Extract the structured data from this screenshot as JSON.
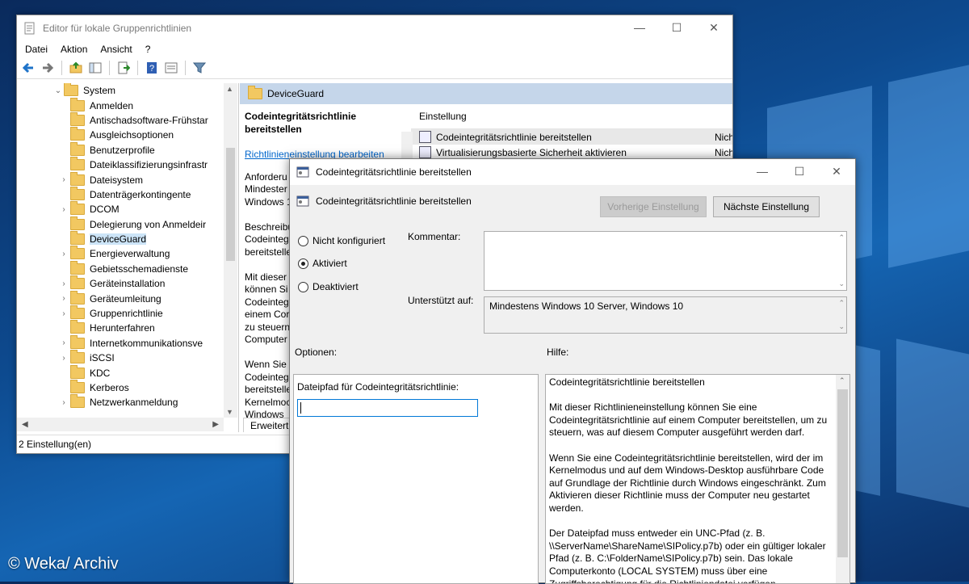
{
  "watermark": "© Weka/ Archiv",
  "main_window": {
    "title": "Editor für lokale Gruppenrichtlinien",
    "menu": [
      "Datei",
      "Aktion",
      "Ansicht",
      "?"
    ],
    "tree": {
      "root": "System",
      "items": [
        {
          "label": "Anmelden",
          "expandable": false
        },
        {
          "label": "Antischadsoftware-Frühstar",
          "expandable": false
        },
        {
          "label": "Ausgleichsoptionen",
          "expandable": false
        },
        {
          "label": "Benutzerprofile",
          "expandable": false
        },
        {
          "label": "Dateiklassifizierungsinfrastr",
          "expandable": false
        },
        {
          "label": "Dateisystem",
          "expandable": true
        },
        {
          "label": "Datenträgerkontingente",
          "expandable": false
        },
        {
          "label": "DCOM",
          "expandable": true
        },
        {
          "label": "Delegierung von Anmeldeir",
          "expandable": false
        },
        {
          "label": "DeviceGuard",
          "expandable": false,
          "selected": true
        },
        {
          "label": "Energieverwaltung",
          "expandable": true
        },
        {
          "label": "Gebietsschemadienste",
          "expandable": false
        },
        {
          "label": "Geräteinstallation",
          "expandable": true
        },
        {
          "label": "Geräteumleitung",
          "expandable": true
        },
        {
          "label": "Gruppenrichtlinie",
          "expandable": true
        },
        {
          "label": "Herunterfahren",
          "expandable": false
        },
        {
          "label": "Internetkommunikationsve",
          "expandable": true
        },
        {
          "label": "iSCSI",
          "expandable": true
        },
        {
          "label": "KDC",
          "expandable": false
        },
        {
          "label": "Kerberos",
          "expandable": false
        },
        {
          "label": "Netzwerkanmeldung",
          "expandable": true
        }
      ]
    },
    "right_pane": {
      "header": "DeviceGuard",
      "desc_title": "Codeintegritätsrichtlinie bereitstellen",
      "desc_link": "Richtlinieneinstellung bearbeiten",
      "desc_lines": [
        "Anforderu",
        "Mindester",
        "Windows 1",
        "",
        "Beschreibu",
        "Codeinteg",
        "bereitstelle",
        "",
        "Mit dieser",
        "können Si",
        "Codeinteg",
        "einem Cor",
        "zu steuern",
        "Computer",
        "",
        "Wenn Sie",
        "Codeinteg",
        "bereitstelle",
        "Kernelmoc",
        "Windows"
      ],
      "column_header": "Einstellung",
      "rows": [
        {
          "label": "Codeintegritätsrichtlinie bereitstellen",
          "state": "Nich"
        },
        {
          "label": "Virtualisierungsbasierte Sicherheit aktivieren",
          "state": "Nich"
        }
      ],
      "tab": "Erweitert"
    },
    "status": "2 Einstellung(en)"
  },
  "dialog": {
    "title": "Codeintegritätsrichtlinie bereitstellen",
    "subtitle": "Codeintegritätsrichtlinie bereitstellen",
    "prev_button": "Vorherige Einstellung",
    "next_button": "Nächste Einstellung",
    "radios": [
      {
        "label": "Nicht konfiguriert",
        "checked": false
      },
      {
        "label": "Aktiviert",
        "checked": true
      },
      {
        "label": "Deaktiviert",
        "checked": false
      }
    ],
    "comment_label": "Kommentar:",
    "comment_value": "",
    "supported_label": "Unterstützt auf:",
    "supported_value": "Mindestens Windows 10 Server, Windows 10",
    "options_label": "Optionen:",
    "help_label": "Hilfe:",
    "filepath_label": "Dateipfad für Codeintegritätsrichtlinie:",
    "filepath_value": "",
    "help_text": "Codeintegritätsrichtlinie bereitstellen\n\nMit dieser Richtlinieneinstellung können Sie eine Codeintegritätsrichtlinie auf einem Computer bereitstellen, um zu steuern, was auf diesem Computer ausgeführt werden darf.\n\nWenn Sie eine Codeintegritätsrichtlinie bereitstellen, wird der im Kernelmodus und auf dem Windows-Desktop ausführbare Code auf Grundlage der Richtlinie durch Windows eingeschränkt. Zum Aktivieren dieser Richtlinie muss der Computer neu gestartet werden.\n\nDer Dateipfad muss entweder ein UNC-Pfad (z. B. \\\\ServerName\\ShareName\\SIPolicy.p7b) oder ein gültiger lokaler Pfad (z. B. C:\\FolderName\\SIPolicy.p7b) sein. Das lokale Computerkonto (LOCAL SYSTEM) muss über eine Zugriffsberechtigung für die Richtliniendatei verfügen."
  }
}
